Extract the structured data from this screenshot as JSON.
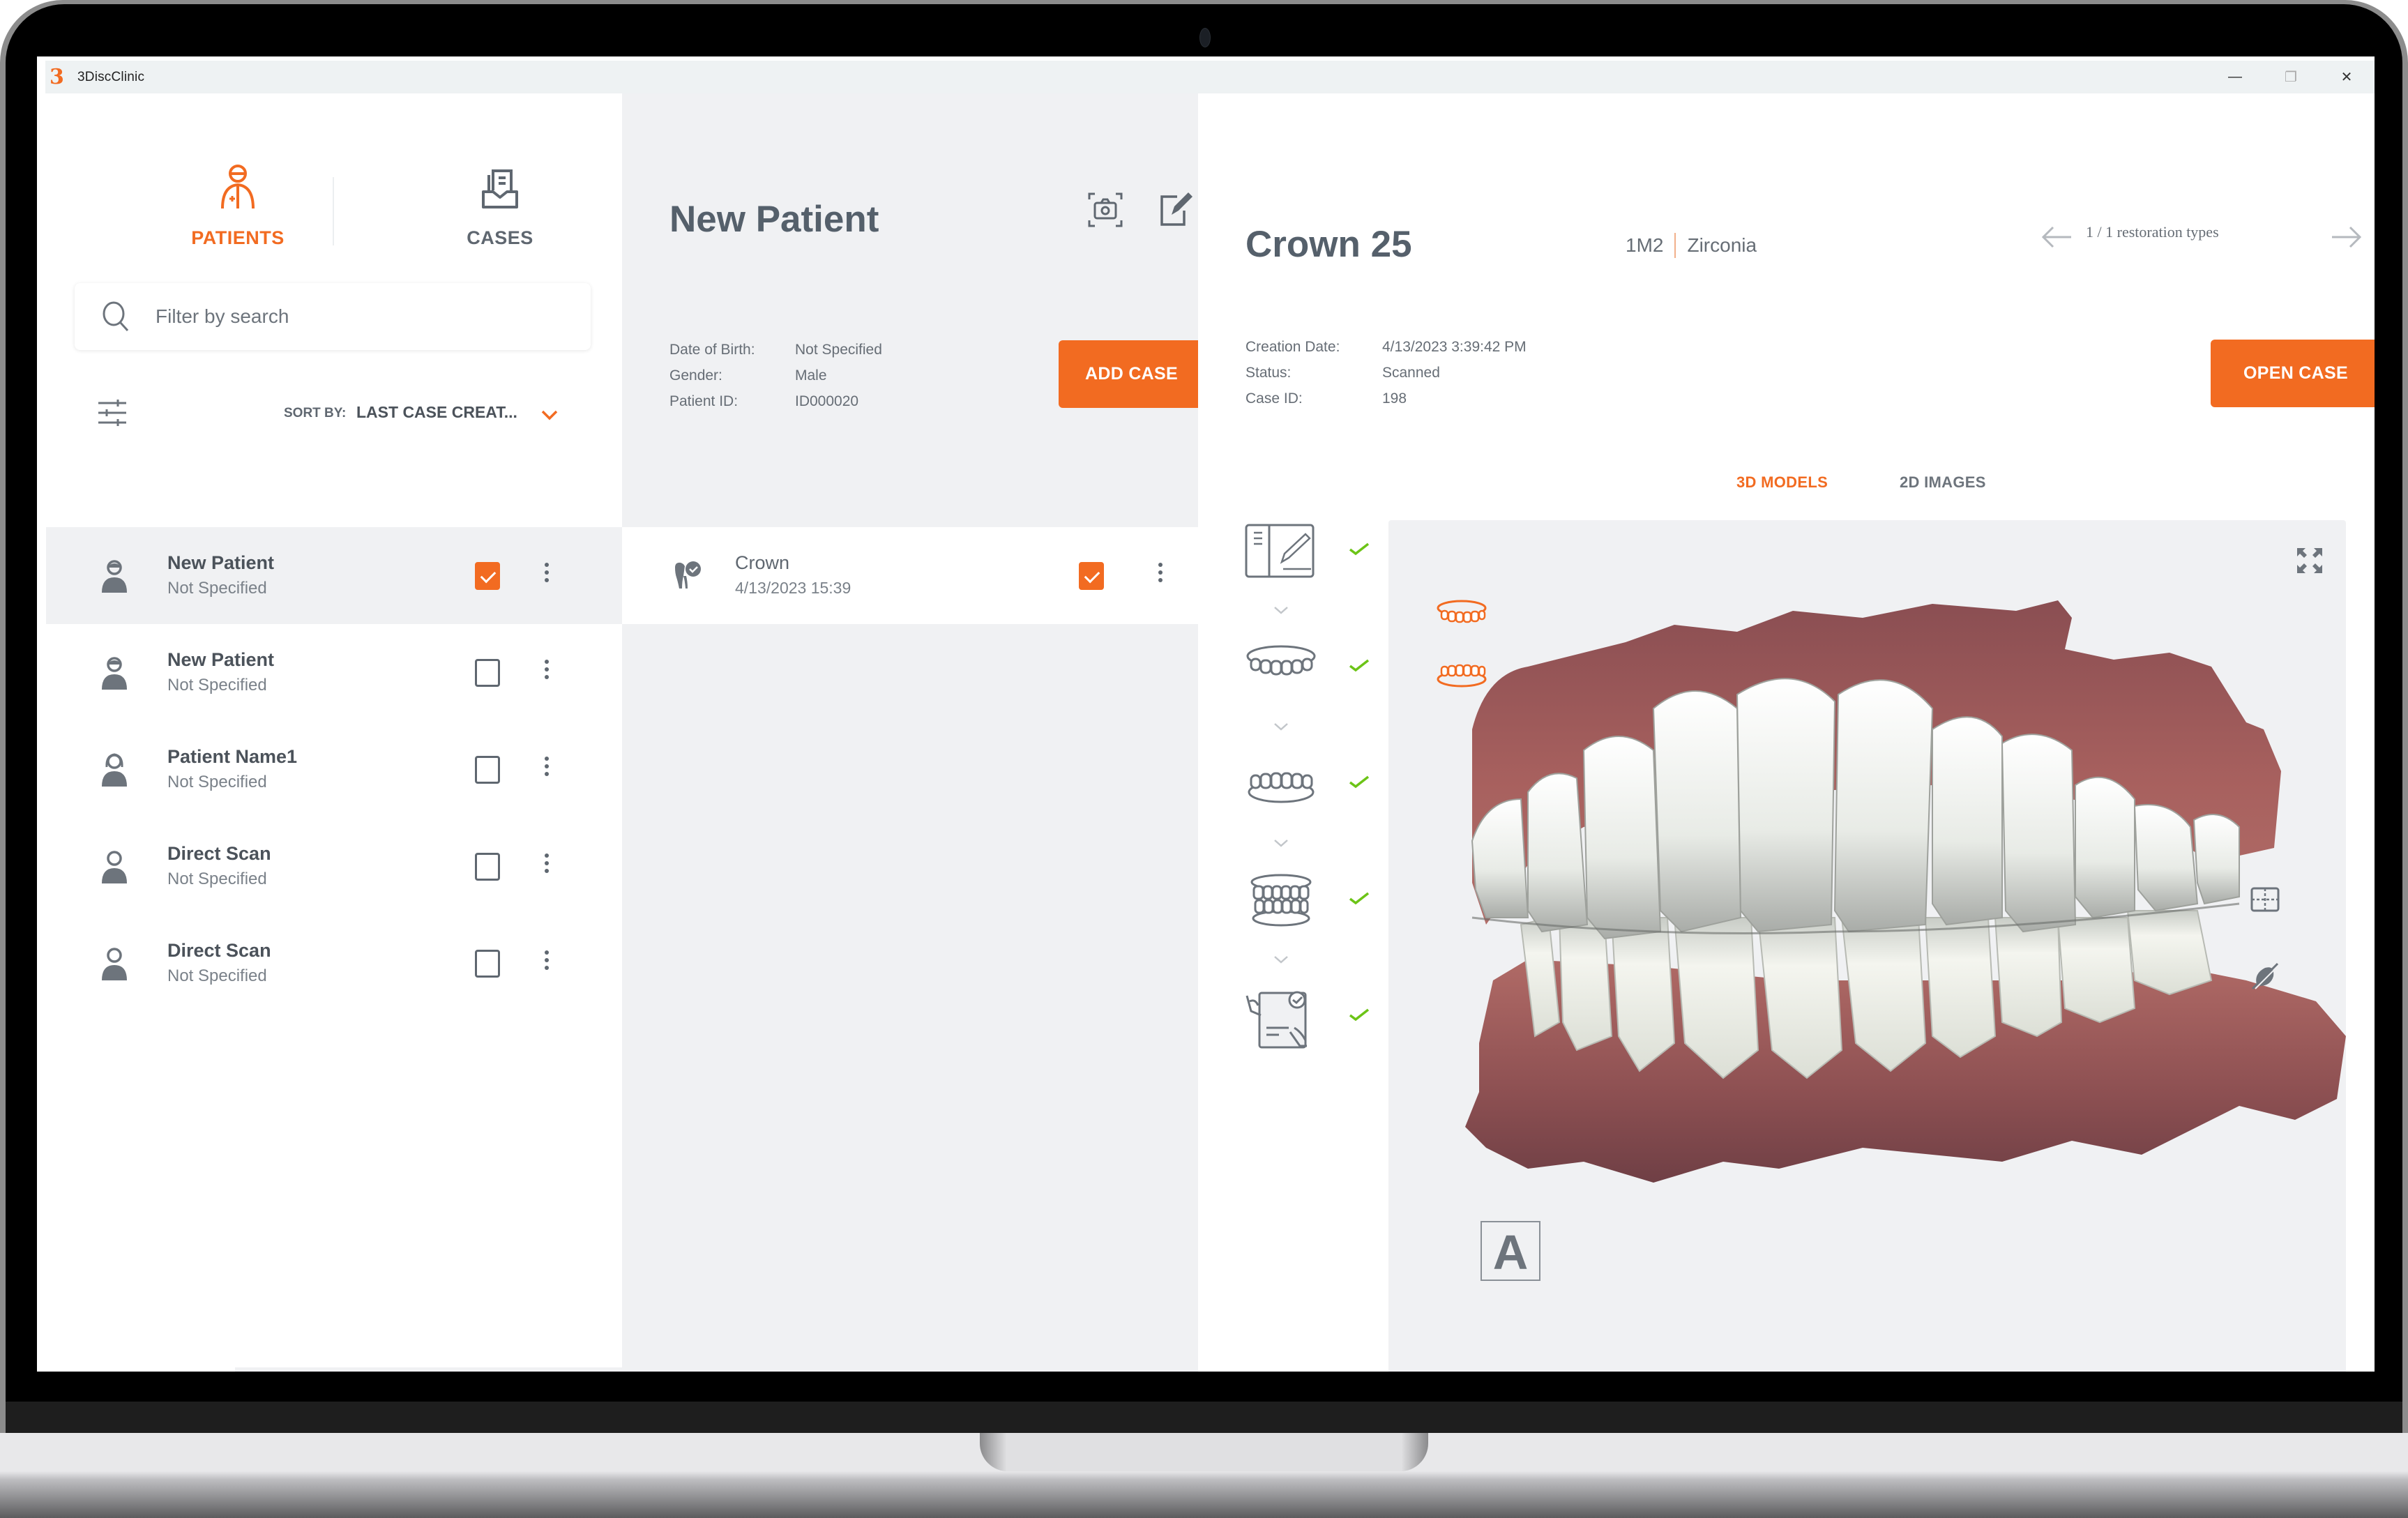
{
  "window": {
    "app_title": "3DiscClinic",
    "controls": {
      "minimize": "—",
      "restore": "❐",
      "close": "✕"
    }
  },
  "colors": {
    "accent": "#f26b21",
    "text_dark": "#4b525a",
    "text_muted": "#7a8189",
    "panel_gray": "#f0f1f3",
    "check_green": "#6cc417"
  },
  "sidebar": {
    "tabs": [
      {
        "label": "PATIENTS",
        "icon": "patient-icon",
        "active": true
      },
      {
        "label": "CASES",
        "icon": "cases-icon",
        "active": false
      }
    ],
    "search": {
      "placeholder": "Filter by search",
      "value": ""
    },
    "sort": {
      "label": "SORT BY:",
      "value": "LAST CASE CREAT..."
    },
    "patients": [
      {
        "name": "New Patient",
        "sub": "Not Specified",
        "avatar": "male-avatar",
        "checked": true,
        "selected": true
      },
      {
        "name": "New Patient",
        "sub": "Not Specified",
        "avatar": "male-avatar",
        "checked": false,
        "selected": false
      },
      {
        "name": "Patient Name1",
        "sub": "Not Specified",
        "avatar": "female-avatar",
        "checked": false,
        "selected": false
      },
      {
        "name": "Direct Scan",
        "sub": "Not Specified",
        "avatar": "neutral-avatar",
        "checked": false,
        "selected": false
      },
      {
        "name": "Direct Scan",
        "sub": "Not Specified",
        "avatar": "neutral-avatar",
        "checked": false,
        "selected": false
      }
    ]
  },
  "patient_detail": {
    "title": "New Patient",
    "fields": [
      {
        "label": "Date of Birth:",
        "value": "Not Specified"
      },
      {
        "label": "Gender:",
        "value": "Male"
      },
      {
        "label": "Patient ID:",
        "value": "ID000020"
      }
    ],
    "add_case_label": "ADD CASE",
    "cases": [
      {
        "name": "Crown",
        "date": "4/13/2023 15:39",
        "checked": true
      }
    ]
  },
  "case_detail": {
    "title": "Crown 25",
    "tooth": "1M2",
    "material": "Zirconia",
    "pager_text": "1 / 1 restoration types",
    "fields": [
      {
        "label": "Creation Date:",
        "value": "4/13/2023 3:39:42 PM"
      },
      {
        "label": "Status:",
        "value": "Scanned"
      },
      {
        "label": "Case ID:",
        "value": "198"
      }
    ],
    "open_case_label": "OPEN CASE",
    "tabs": [
      {
        "label": "3D MODELS",
        "active": true
      },
      {
        "label": "2D IMAGES",
        "active": false
      }
    ],
    "workflow_steps": [
      {
        "name": "prescription-form",
        "done": true
      },
      {
        "name": "upper-jaw-scan",
        "done": true
      },
      {
        "name": "lower-jaw-scan",
        "done": true
      },
      {
        "name": "bite-scan",
        "done": true
      },
      {
        "name": "review-approve",
        "done": true
      }
    ],
    "viewer": {
      "view_label": "A"
    }
  }
}
